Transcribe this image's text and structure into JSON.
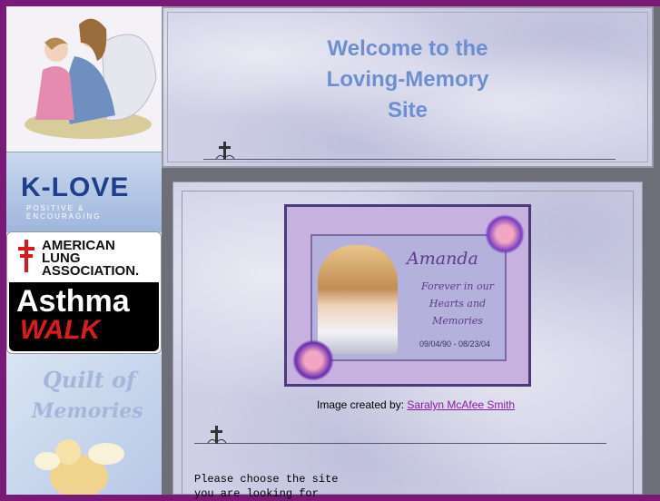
{
  "header": {
    "title_line1": "Welcome to the",
    "title_line2": "Loving-Memory",
    "title_line3": "Site"
  },
  "sidebar": {
    "ads": [
      {
        "name": "angel-figurine-ad"
      },
      {
        "name": "klove-ad",
        "label": "K-LOVE",
        "tagline": "Positive & Encouraging"
      },
      {
        "name": "asthma-walk-ad",
        "line1": "AMERICAN",
        "line2": "LUNG",
        "line3": "ASSOCIATION.",
        "word1": "Asthma",
        "word2": "WALK"
      },
      {
        "name": "quilt-ad",
        "line1": "Quilt of",
        "line2": "Memories"
      }
    ]
  },
  "memorial": {
    "name": "Amanda",
    "line1": "Forever in our",
    "line2": "Hearts and",
    "line3": "Memories",
    "dates": "09/04/90 - 08/23/04"
  },
  "caption": {
    "prefix": "Image created by: ",
    "link": "Saralyn McAfee Smith"
  },
  "body_text": {
    "line1": "Please choose the site",
    "line2": "you are looking for"
  },
  "colors": {
    "border_purple": "#7a1a78",
    "title_blue": "#6d8fd2",
    "link_purple": "#8a1aa0"
  }
}
